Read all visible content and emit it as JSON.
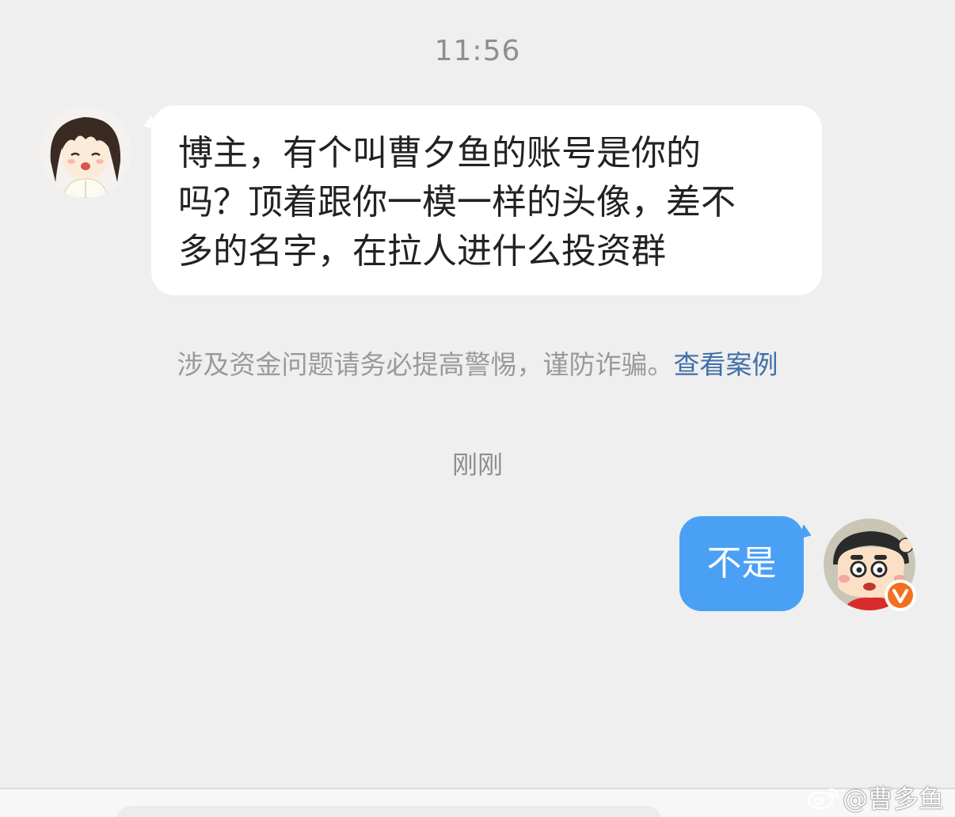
{
  "chat": {
    "time_1": "11:56",
    "incoming_message": "博主，有个叫曹夕鱼的账号是你的\n吗？顶着跟你一模一样的头像，差不\n多的名字，在拉人进什么投资群",
    "notice_text": "涉及资金问题请务必提高警惕，谨防诈骗。",
    "notice_link": "查看案例",
    "time_2": "刚刚",
    "outgoing_message": "不是"
  },
  "watermark": "@曹多鱼",
  "icons": {
    "incoming_avatar": "anime-girl-avatar",
    "outgoing_avatar": "cartoon-boy-avatar",
    "verified_badge": "verified-v-icon",
    "weibo_logo": "weibo-logo-icon"
  },
  "colors": {
    "background": "#efefef",
    "incoming_bubble": "#ffffff",
    "outgoing_bubble": "#4aa0f5",
    "link": "#3f6fa8",
    "verified_badge": "#f37021"
  }
}
